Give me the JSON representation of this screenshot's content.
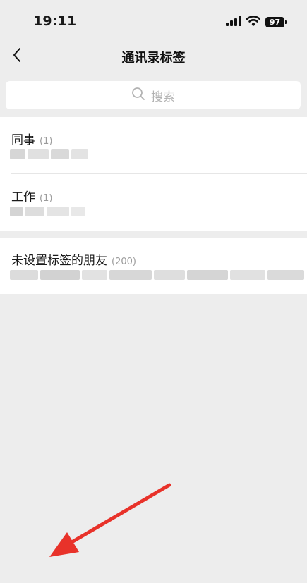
{
  "status_bar": {
    "time": "19:11",
    "battery": "97",
    "icons": [
      "signal-icon",
      "wifi-icon",
      "battery-icon"
    ]
  },
  "nav": {
    "title": "通讯录标签",
    "back_icon": "chevron-left-icon"
  },
  "search": {
    "placeholder": "搜索",
    "icon": "search-icon"
  },
  "tag_groups": [
    {
      "items": [
        {
          "name": "同事",
          "count": "(1)"
        },
        {
          "name": "工作",
          "count": "(1)"
        }
      ]
    },
    {
      "items": [
        {
          "name": "未设置标签的朋友",
          "count": "(200)"
        }
      ]
    }
  ],
  "colors": {
    "background": "#ededed",
    "card": "#ffffff",
    "secondary_text": "#9b9b9b",
    "annotation_arrow": "#e8322a"
  }
}
